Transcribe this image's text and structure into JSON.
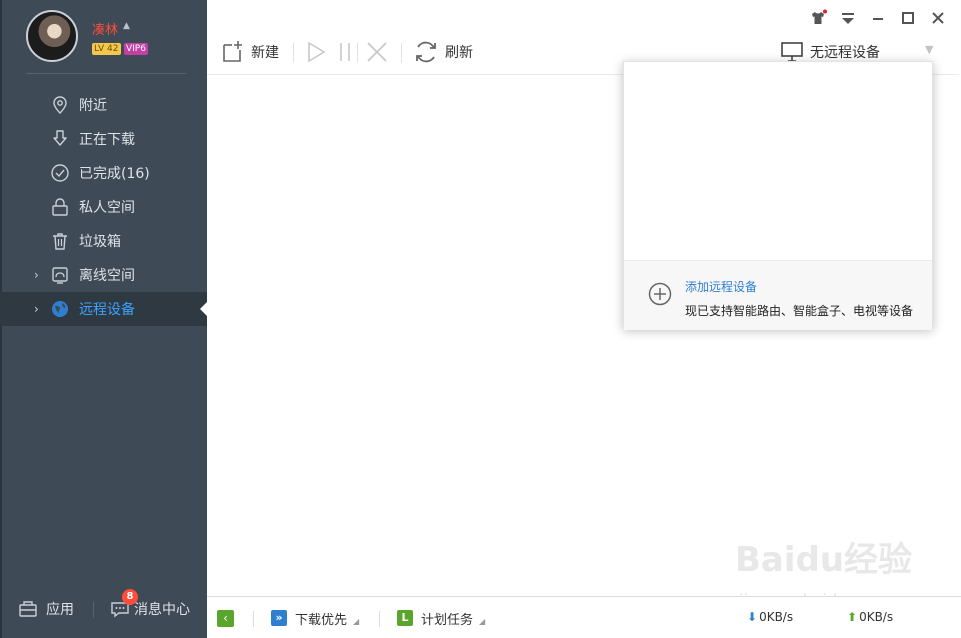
{
  "user": {
    "name": "凑林",
    "level_badge": "LV 42",
    "vip_badge": "VIP6"
  },
  "sidebar": {
    "items": [
      {
        "label": "附近",
        "icon": "location-pin-icon"
      },
      {
        "label": "正在下载",
        "icon": "download-icon"
      },
      {
        "label": "已完成(16)",
        "icon": "check-circle-icon"
      },
      {
        "label": "私人空间",
        "icon": "lock-icon"
      },
      {
        "label": "垃圾箱",
        "icon": "trash-icon"
      },
      {
        "label": "离线空间",
        "icon": "offline-space-icon"
      },
      {
        "label": "远程设备",
        "icon": "globe-icon"
      }
    ],
    "active_item": "远程设备",
    "bottom": {
      "apps_label": "应用",
      "messages_label": "消息中心",
      "messages_count": "8"
    }
  },
  "toolbar": {
    "new_label": "新建",
    "refresh_label": "刷新",
    "remote_device_label": "无远程设备"
  },
  "remote_dropdown": {
    "add_title": "添加远程设备",
    "add_description": "现已支持智能路由、智能盒子、电视等设备"
  },
  "statusbar": {
    "download_priority_label": "下载优先",
    "scheduled_tasks_label": "计划任务",
    "download_speed": "0KB/s",
    "upload_speed": "0KB/s"
  },
  "watermark": {
    "text": "Baidu经验",
    "url": "jingyan.baidu.com"
  },
  "colors": {
    "sidebar_bg": "#3e4a55",
    "active_text": "#3da2ff",
    "username": "#ff4d3a",
    "link_blue": "#2f7fd1",
    "green": "#5aa52c"
  }
}
